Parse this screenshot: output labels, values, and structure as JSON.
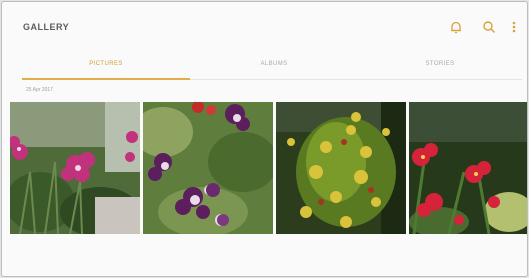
{
  "app": {
    "title": "GALLERY"
  },
  "toolbar": {
    "icons": [
      "bell-icon",
      "search-icon",
      "more-options-icon"
    ],
    "accent_color": "#e2ac4a"
  },
  "tabs": [
    {
      "label": "PICTURES",
      "selected": true
    },
    {
      "label": "ALBUMS",
      "selected": false
    },
    {
      "label": "STORIES",
      "selected": false
    }
  ],
  "section": {
    "date_header": "25 Apr 2017"
  },
  "photos": [
    {
      "subject": "pink-flowers"
    },
    {
      "subject": "purple-columbine"
    },
    {
      "subject": "yellow-shrub"
    },
    {
      "subject": "red-flowers"
    }
  ]
}
